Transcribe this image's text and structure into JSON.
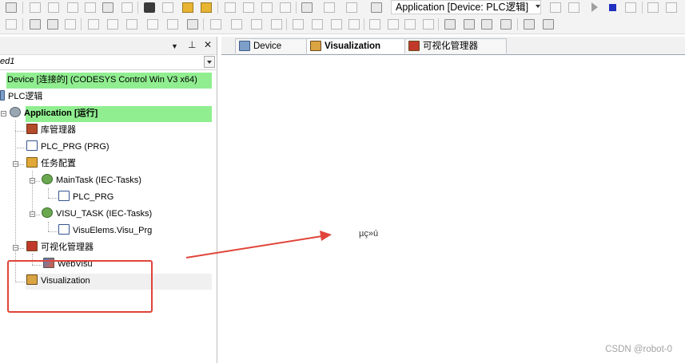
{
  "toolbar": {
    "application_selector": "Application [Device: PLC逻辑]",
    "row1_icons": [
      "print-icon",
      "undo-icon",
      "redo-icon",
      "cut-icon",
      "copy-icon",
      "paste-icon",
      "delete-icon",
      "find-icon",
      "find-replace-icon",
      "bookmark-icon",
      "build-icon",
      "generate-code-icon",
      "login-icon",
      "logout-icon"
    ],
    "row2_icons": [
      "align-left-icon",
      "align-center-icon",
      "align-right-icon",
      "align-top-icon",
      "align-middle-icon",
      "align-bottom-icon",
      "same-width-icon",
      "same-height-icon",
      "group-icon",
      "ungroup-icon",
      "bring-front-icon",
      "send-back-icon"
    ]
  },
  "devices_pane": {
    "project_name": "ed1",
    "tree": [
      {
        "label": "Device [连接的] (CODESYS Control Win V3 x64)",
        "icon": "device-icon"
      },
      {
        "label": "PLC逻辑",
        "icon": "plc-logic-icon"
      },
      {
        "label": "Application [运行]",
        "icon": "application-gear-icon"
      },
      {
        "label": "库管理器",
        "icon": "library-manager-icon"
      },
      {
        "label": "PLC_PRG (PRG)",
        "icon": "pou-icon"
      },
      {
        "label": "任务配置",
        "icon": "task-configuration-icon"
      },
      {
        "label": "MainTask (IEC-Tasks)",
        "icon": "task-icon"
      },
      {
        "label": "PLC_PRG",
        "icon": "program-call-icon"
      },
      {
        "label": "VISU_TASK (IEC-Tasks)",
        "icon": "task-icon"
      },
      {
        "label": "VisuElems.Visu_Prg",
        "icon": "program-call-icon"
      },
      {
        "label": "可视化管理器",
        "icon": "visualization-manager-icon"
      },
      {
        "label": "WebVisu",
        "icon": "webvisu-icon"
      },
      {
        "label": "Visualization",
        "icon": "visualization-icon"
      }
    ]
  },
  "editor": {
    "tabs": [
      {
        "label": "Device",
        "icon": "device-icon",
        "active": false
      },
      {
        "label": "Visualization",
        "icon": "visualization-icon",
        "active": true
      },
      {
        "label": "可视化管理器",
        "icon": "visualization-manager-icon",
        "active": false
      }
    ],
    "content_text": "µç»ú"
  },
  "annotation": {
    "box_color": "#e0443a",
    "arrow_color": "#e0443a"
  },
  "watermark": "CSDN @robot-0",
  "colors": {
    "online_highlight": "#90ee90",
    "selection": "#f0f0f0"
  }
}
